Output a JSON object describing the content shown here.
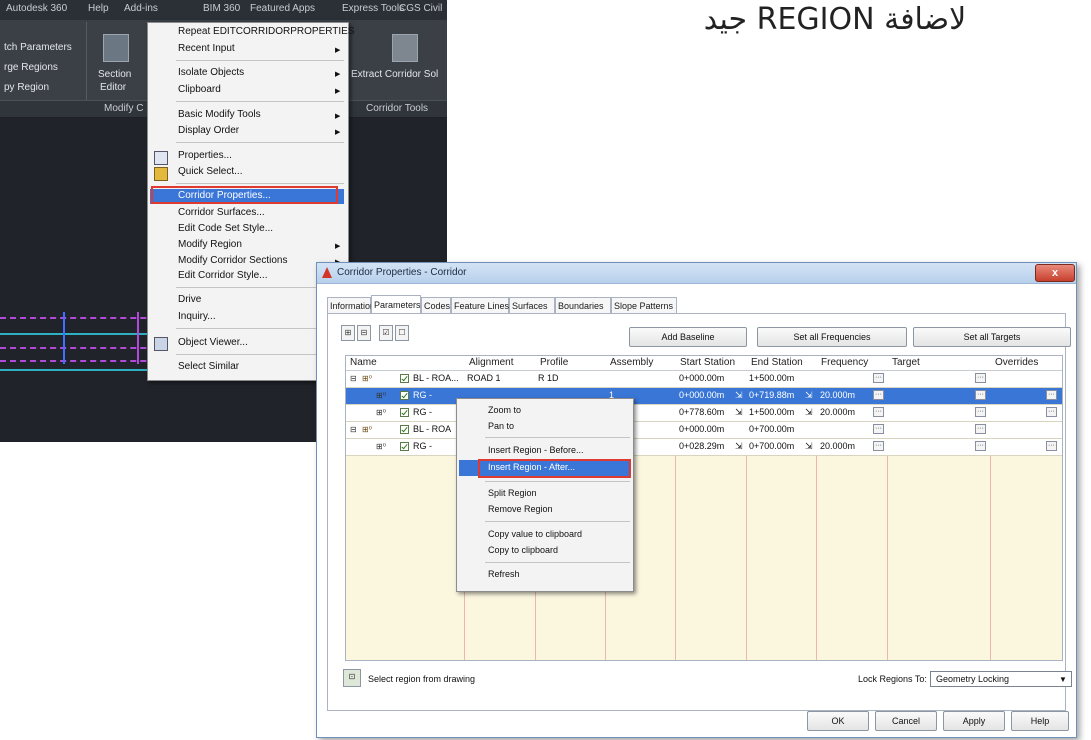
{
  "caption": "لاضافة REGION جيد",
  "acad": {
    "menu_tabs": [
      "Autodesk 360",
      "Help",
      "Add-ins",
      "BIM 360",
      "Featured Apps",
      "Express Tools",
      "CGS Civil"
    ],
    "ribbon_left": [
      "tch Parameters",
      "rge Regions",
      "py Region"
    ],
    "section_editor": [
      "Section",
      "Editor"
    ],
    "extract_label": "Extract Corridor Sol",
    "panel_modify": "Modify C",
    "panel_corridor_tools": "Corridor Tools"
  },
  "context_menu": {
    "items": [
      {
        "label": "Repeat EDITCORRIDORPROPERTIES",
        "arrow": false
      },
      {
        "label": "Recent Input",
        "arrow": true
      },
      {
        "label": "Isolate Objects",
        "arrow": true
      },
      {
        "label": "Clipboard",
        "arrow": true
      },
      {
        "label": "Basic Modify Tools",
        "arrow": true
      },
      {
        "label": "Display Order",
        "arrow": true
      },
      {
        "label": "Properties...",
        "arrow": false
      },
      {
        "label": "Quick Select...",
        "arrow": false
      },
      {
        "label": "Corridor Properties...",
        "arrow": false
      },
      {
        "label": "Corridor Surfaces...",
        "arrow": false
      },
      {
        "label": "Edit Code Set Style...",
        "arrow": false
      },
      {
        "label": "Modify Region",
        "arrow": true
      },
      {
        "label": "Modify Corridor Sections",
        "arrow": true
      },
      {
        "label": "Edit Corridor Style...",
        "arrow": false
      },
      {
        "label": "Drive",
        "arrow": false
      },
      {
        "label": "Inquiry...",
        "arrow": false
      },
      {
        "label": "Object Viewer...",
        "arrow": false
      },
      {
        "label": "Select Similar",
        "arrow": false
      }
    ]
  },
  "dialog": {
    "title": "Corridor Properties - Corridor",
    "close": "x",
    "tabs": [
      "Information",
      "Parameters",
      "Codes",
      "Feature Lines",
      "Surfaces",
      "Boundaries",
      "Slope Patterns"
    ],
    "buttons": {
      "add_baseline": "Add Baseline",
      "set_all_frequencies": "Set all Frequencies",
      "set_all_targets": "Set all Targets",
      "ok": "OK",
      "cancel": "Cancel",
      "apply": "Apply",
      "help": "Help"
    },
    "columns": [
      "Name",
      "Alignment",
      "Profile",
      "Assembly",
      "Start Station",
      "End Station",
      "Frequency",
      "Target",
      "Overrides"
    ],
    "rows": [
      {
        "name": "BL - ROA...",
        "alignment": "ROAD 1",
        "profile": "R 1D",
        "assembly": "",
        "start": "0+000.00m",
        "end": "1+500.00m",
        "frequency": ""
      },
      {
        "name": "RG -",
        "alignment": "",
        "profile": "",
        "assembly": "1",
        "start": "0+000.00m",
        "end": "0+719.88m",
        "frequency": "20.000m"
      },
      {
        "name": "RG -",
        "alignment": "",
        "profile": "",
        "assembly": "",
        "start": "0+778.60m",
        "end": "1+500.00m",
        "frequency": "20.000m"
      },
      {
        "name": "BL - ROA",
        "alignment": "",
        "profile": "",
        "assembly": "",
        "start": "0+000.00m",
        "end": "0+700.00m",
        "frequency": ""
      },
      {
        "name": "RG -",
        "alignment": "",
        "profile": "",
        "assembly": "",
        "start": "0+028.29m",
        "end": "0+700.00m",
        "frequency": "20.000m"
      }
    ],
    "footer": {
      "select_region": "Select region from drawing",
      "lock_label": "Lock Regions To:",
      "lock_value": "Geometry Locking"
    }
  },
  "grid_menu": {
    "items": [
      "Zoom to",
      "Pan to",
      "Insert Region - Before...",
      "Insert Region - After...",
      "Split Region",
      "Remove Region",
      "Copy value to clipboard",
      "Copy to clipboard",
      "Refresh"
    ]
  }
}
